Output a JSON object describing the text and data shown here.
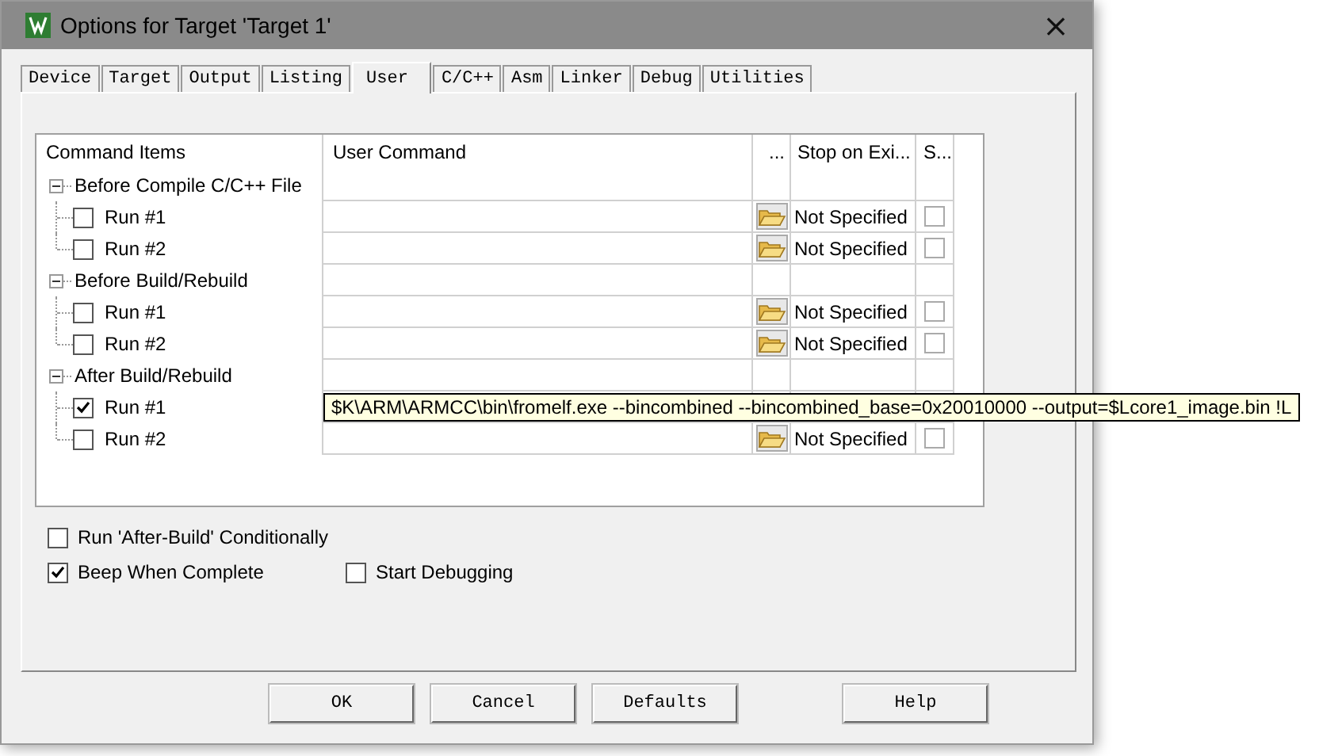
{
  "window": {
    "title": "Options for Target 'Target 1'",
    "close": "×"
  },
  "tabs": [
    {
      "label": "Device",
      "selected": false
    },
    {
      "label": "Target",
      "selected": false
    },
    {
      "label": "Output",
      "selected": false
    },
    {
      "label": "Listing",
      "selected": false
    },
    {
      "label": "User",
      "selected": true
    },
    {
      "label": "C/C++",
      "selected": false
    },
    {
      "label": "Asm",
      "selected": false
    },
    {
      "label": "Linker",
      "selected": false
    },
    {
      "label": "Debug",
      "selected": false
    },
    {
      "label": "Utilities",
      "selected": false
    }
  ],
  "table": {
    "columns": [
      "Command Items",
      "User Command",
      "...",
      "Stop on Exi...",
      "S..."
    ],
    "groups": [
      {
        "label": "Before Compile C/C++ File",
        "expanded": true,
        "children": [
          {
            "label": "Run #1",
            "checked": false,
            "stop_on_exit": "Not Specified",
            "s_checked": false
          },
          {
            "label": "Run #2",
            "checked": false,
            "stop_on_exit": "Not Specified",
            "s_checked": false
          }
        ]
      },
      {
        "label": "Before Build/Rebuild",
        "expanded": true,
        "children": [
          {
            "label": "Run #1",
            "checked": false,
            "stop_on_exit": "Not Specified",
            "s_checked": false
          },
          {
            "label": "Run #2",
            "checked": false,
            "stop_on_exit": "Not Specified",
            "s_checked": false
          }
        ]
      },
      {
        "label": "After Build/Rebuild",
        "expanded": true,
        "children": [
          {
            "label": "Run #1",
            "checked": true,
            "command_tooltip": "$K\\ARM\\ARMCC\\bin\\fromelf.exe --bincombined --bincombined_base=0x20010000 --output=$Lcore1_image.bin !L"
          },
          {
            "label": "Run #2",
            "checked": false,
            "stop_on_exit": "Not Specified",
            "s_checked": false
          }
        ]
      }
    ]
  },
  "options": [
    {
      "label": "Run 'After-Build' Conditionally",
      "checked": false
    },
    {
      "label": "Beep When Complete",
      "checked": true
    },
    {
      "label": "Start Debugging",
      "checked": false
    }
  ],
  "buttons": [
    "OK",
    "Cancel",
    "Defaults",
    "Help"
  ]
}
